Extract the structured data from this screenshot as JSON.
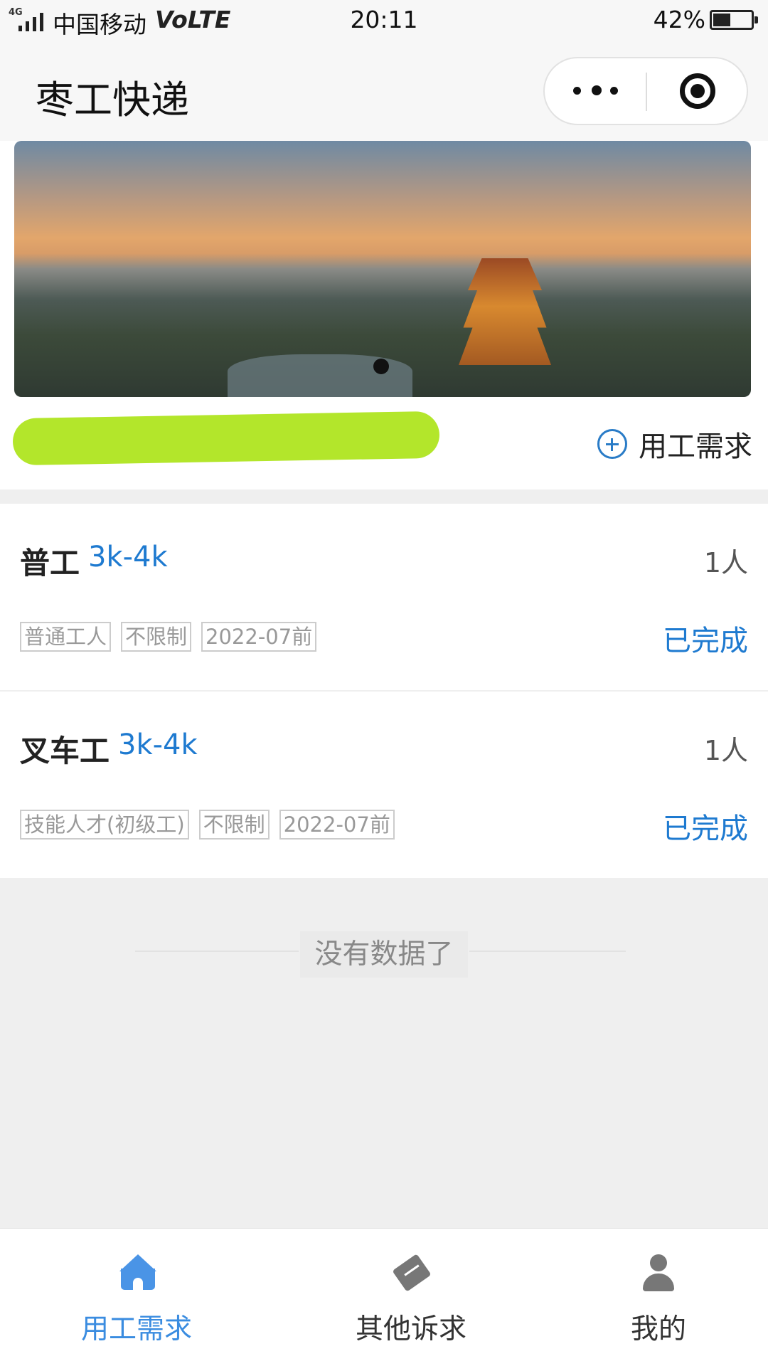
{
  "status_bar": {
    "network": "4G",
    "carrier": "中国移动",
    "volte": "VoLTE",
    "time": "20:11",
    "battery": "42%",
    "battery_level": 0.42
  },
  "nav": {
    "title": "枣工快递"
  },
  "header": {
    "add_demand_label": "用工需求"
  },
  "jobs": [
    {
      "title": "普工",
      "salary": "3k-4k",
      "count": "1人",
      "tags": [
        "普通工人",
        "不限制",
        "2022-07前"
      ],
      "state": "已完成"
    },
    {
      "title": "叉车工",
      "salary": "3k-4k",
      "count": "1人",
      "tags": [
        "技能人才(初级工)",
        "不限制",
        "2022-07前"
      ],
      "state": "已完成"
    }
  ],
  "list_end": "没有数据了",
  "tabs": [
    {
      "label": "用工需求",
      "icon": "home-icon",
      "active": true
    },
    {
      "label": "其他诉求",
      "icon": "mail-icon",
      "active": false
    },
    {
      "label": "我的",
      "icon": "user-icon",
      "active": false
    }
  ],
  "colors": {
    "accent": "#1e7ad0",
    "tab_active": "#3a8ce0",
    "redaction": "#b3e62b"
  }
}
